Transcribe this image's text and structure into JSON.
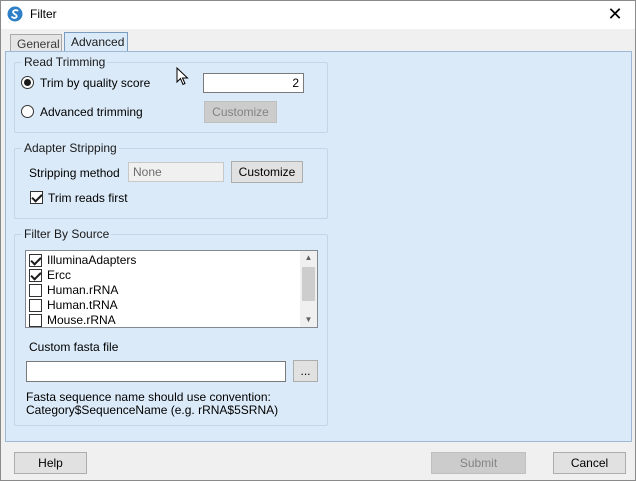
{
  "window": {
    "title": "Filter"
  },
  "tabs": [
    {
      "label": "General",
      "active": false
    },
    {
      "label": "Advanced",
      "active": true
    }
  ],
  "read_trimming": {
    "group_label": "Read Trimming",
    "option_quality_label": "Trim by quality score",
    "option_quality_selected": true,
    "quality_value": "2",
    "option_advanced_label": "Advanced trimming",
    "option_advanced_selected": false,
    "customize_label": "Customize",
    "customize_enabled": false
  },
  "adapter_stripping": {
    "group_label": "Adapter Stripping",
    "method_label": "Stripping method",
    "method_value": "None",
    "customize_label": "Customize",
    "trim_first_label": "Trim reads first",
    "trim_first_checked": true
  },
  "filter_by_source": {
    "group_label": "Filter By Source",
    "items": [
      {
        "label": "IlluminaAdapters",
        "checked": true
      },
      {
        "label": "Ercc",
        "checked": true
      },
      {
        "label": "Human.rRNA",
        "checked": false
      },
      {
        "label": "Human.tRNA",
        "checked": false
      },
      {
        "label": "Mouse.rRNA",
        "checked": false
      }
    ],
    "custom_fasta_label": "Custom fasta file",
    "custom_fasta_value": "",
    "browse_label": "...",
    "note_line1": "Fasta sequence name should use convention:",
    "note_line2": "Category$SequenceName (e.g. rRNA$5SRNA)"
  },
  "footer": {
    "help_label": "Help",
    "submit_label": "Submit",
    "submit_enabled": false,
    "cancel_label": "Cancel"
  },
  "icons": {
    "app": "app-logo-icon",
    "close": "close-icon",
    "scroll_up": "chevron-up-icon",
    "scroll_down": "chevron-down-icon",
    "cursor": "mouse-cursor-icon"
  },
  "colors": {
    "panel_bg": "#dbeaf8",
    "app_icon": "#2f7fc8"
  }
}
